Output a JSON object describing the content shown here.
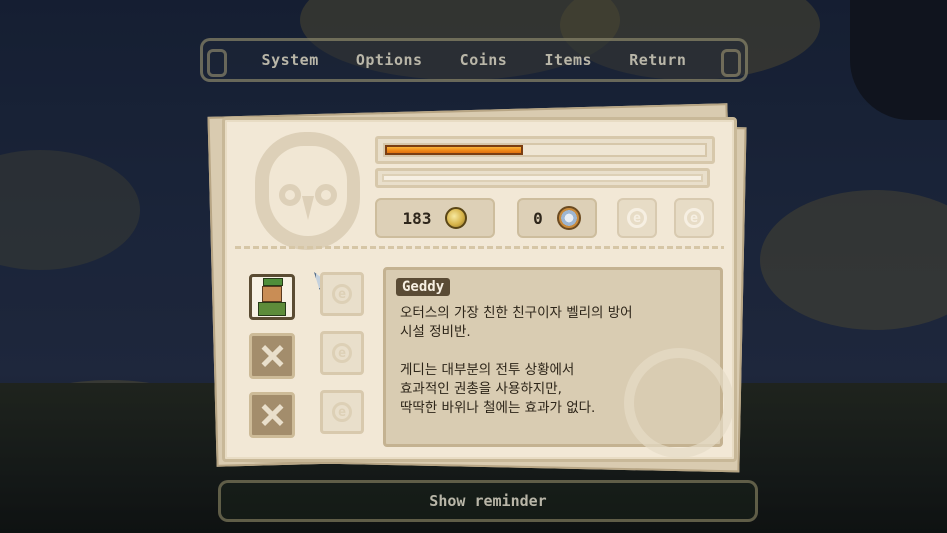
{
  "menu": {
    "items": [
      {
        "label": "System"
      },
      {
        "label": "Options"
      },
      {
        "label": "Coins"
      },
      {
        "label": "Items"
      },
      {
        "label": "Return"
      }
    ]
  },
  "status": {
    "hp_fraction": 0.43,
    "xp_fraction": 0.0,
    "coins": "183",
    "gears": "0",
    "hp_color": "#f08a19"
  },
  "character": {
    "name": "Geddy",
    "description": "오터스의 가장 친한 친구이자 벨리의 방어\n시설 정비반.\n\n게디는 대부분의 전투 상황에서\n효과적인 권총을 사용하지만,\n딱딱한 바위나 철에는 효과가 없다."
  },
  "icons": {
    "coin": "coin-icon",
    "gear": "gear-icon",
    "empty_slot": "e-glyph-icon",
    "locked_slot": "locked-icon"
  },
  "footer": {
    "reminder_label": "Show reminder"
  }
}
